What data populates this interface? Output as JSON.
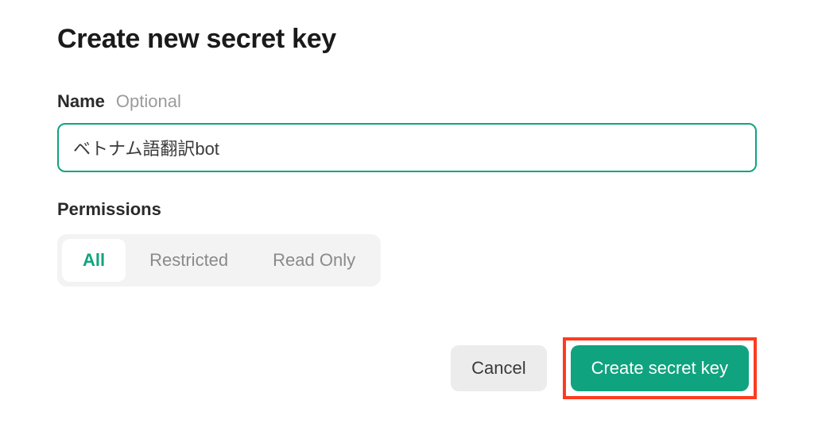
{
  "dialog": {
    "title": "Create new secret key"
  },
  "name_field": {
    "label": "Name",
    "optional": "Optional",
    "value": "ベトナム語翻訳bot"
  },
  "permissions": {
    "label": "Permissions",
    "options": [
      "All",
      "Restricted",
      "Read Only"
    ],
    "selected": "All"
  },
  "actions": {
    "cancel": "Cancel",
    "create": "Create secret key"
  },
  "colors": {
    "accent": "#10a37f",
    "highlight": "#ff3b1f"
  }
}
